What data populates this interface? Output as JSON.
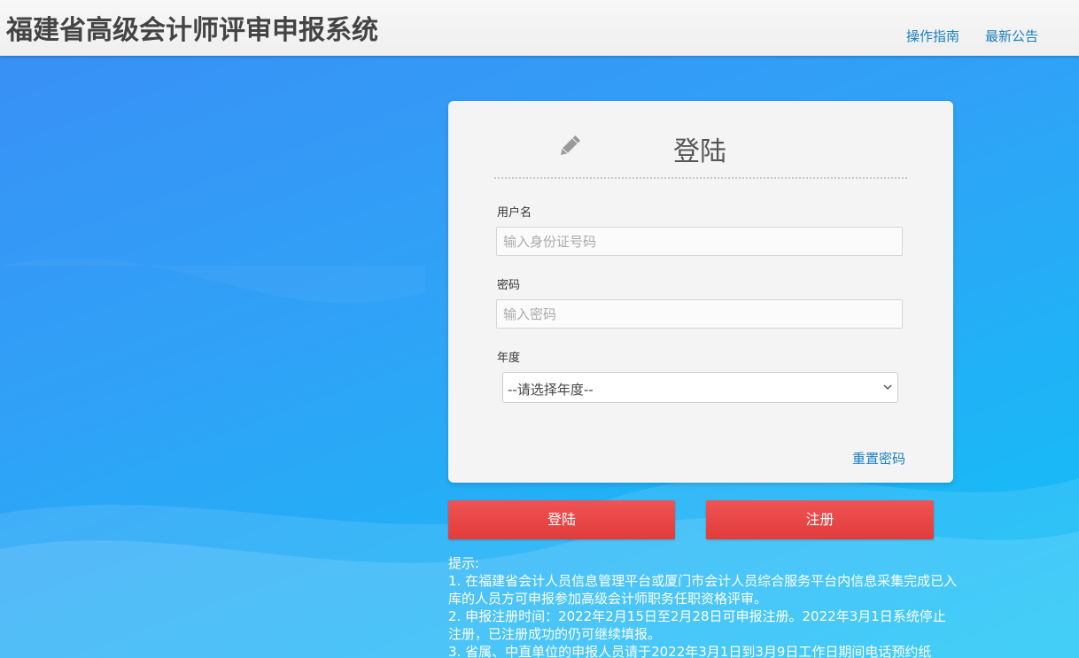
{
  "header": {
    "title": "福建省高级会计师评审申报系统",
    "nav": [
      {
        "label": "操作指南"
      },
      {
        "label": "最新公告"
      }
    ]
  },
  "login_form": {
    "title": "登陆",
    "title_icon": "pencil-icon",
    "username": {
      "label": "用户名",
      "placeholder": "输入身份证号码",
      "value": ""
    },
    "password": {
      "label": "密码",
      "placeholder": "输入密码",
      "value": ""
    },
    "year": {
      "label": "年度",
      "selected": "--请选择年度--"
    },
    "reset_password_label": "重置密码"
  },
  "buttons": {
    "login_label": "登陆",
    "register_label": "注册"
  },
  "notice": {
    "heading": "提示:",
    "items": [
      "1. 在福建省会计人员信息管理平台或厦门市会计人员综合服务平台内信息采集完成已入库的人员方可申报参加高级会计师职务任职资格评审。",
      "2. 申报注册时间：2022年2月15日至2月28日可申报注册。2022年3月1日系统停止注册，已注册成功的仍可继续填报。",
      "3. 省属、中直单位的申报人员请于2022年3月1日到3月9日工作日期间电话预约纸"
    ]
  },
  "colors": {
    "header_bg": "#f2f2f2",
    "accent_link": "#1a7fc1",
    "button_red": "#e84545",
    "background_blue": "#2fa3f7"
  }
}
